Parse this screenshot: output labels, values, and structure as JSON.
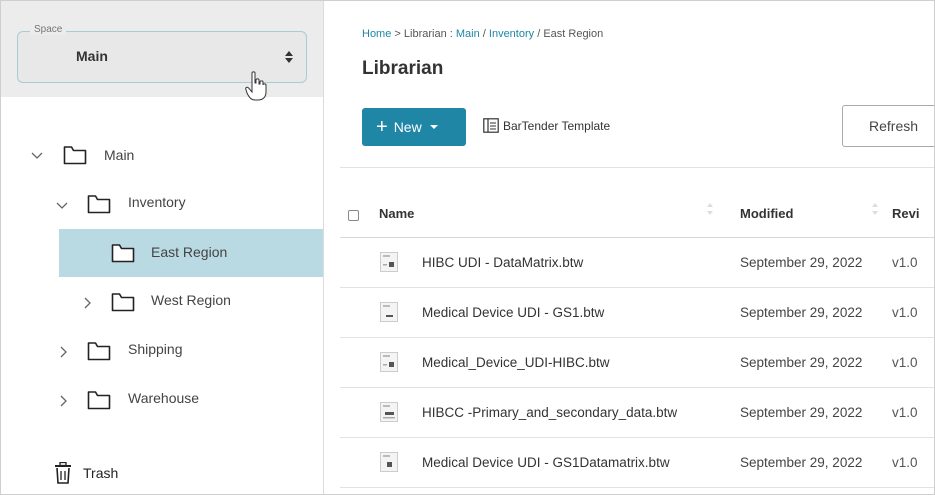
{
  "space": {
    "legend": "Space",
    "value": "Main"
  },
  "tree": [
    {
      "label": "Main",
      "expanded": true
    },
    {
      "label": "Inventory",
      "expanded": true
    },
    {
      "label": "East Region",
      "selected": true
    },
    {
      "label": "West Region",
      "expanded": false
    },
    {
      "label": "Shipping",
      "expanded": false
    },
    {
      "label": "Warehouse",
      "expanded": false
    }
  ],
  "trash": {
    "label": "Trash"
  },
  "breadcrumb": {
    "home": "Home",
    "sep1": " > ",
    "lib": "Librarian",
    "sep2": " : ",
    "main": "Main",
    "sep3": " / ",
    "inventory": "Inventory",
    "sep4": " / ",
    "east": "East Region"
  },
  "page": {
    "title": "Librarian"
  },
  "toolbar": {
    "new_label": "New",
    "bartender_label": "BarTender Template",
    "refresh_label": "Refresh"
  },
  "table": {
    "columns": {
      "name": "Name",
      "modified": "Modified",
      "revision": "Revi"
    },
    "rows": [
      {
        "name": "HIBC UDI - DataMatrix.btw",
        "modified": "September 29, 2022",
        "revision": "v1.0"
      },
      {
        "name": "Medical Device UDI - GS1.btw",
        "modified": "September 29, 2022",
        "revision": "v1.0"
      },
      {
        "name": "Medical_Device_UDI-HIBC.btw",
        "modified": "September 29, 2022",
        "revision": "v1.0"
      },
      {
        "name": "HIBCC -Primary_and_secondary_data.btw",
        "modified": "September 29, 2022",
        "revision": "v1.0"
      },
      {
        "name": "Medical Device UDI - GS1Datamatrix.btw",
        "modified": "September 29, 2022",
        "revision": "v1.0"
      }
    ]
  },
  "colors": {
    "accent": "#1f86a6",
    "selected_row": "#b9dae2",
    "space_bg": "#ececec"
  },
  "icons": [
    "chevron-down-icon",
    "chevron-right-icon",
    "folder-icon",
    "trash-icon",
    "template-icon",
    "file-icon",
    "sort-icon",
    "up-down-caret-icon",
    "hand-cursor-icon"
  ]
}
